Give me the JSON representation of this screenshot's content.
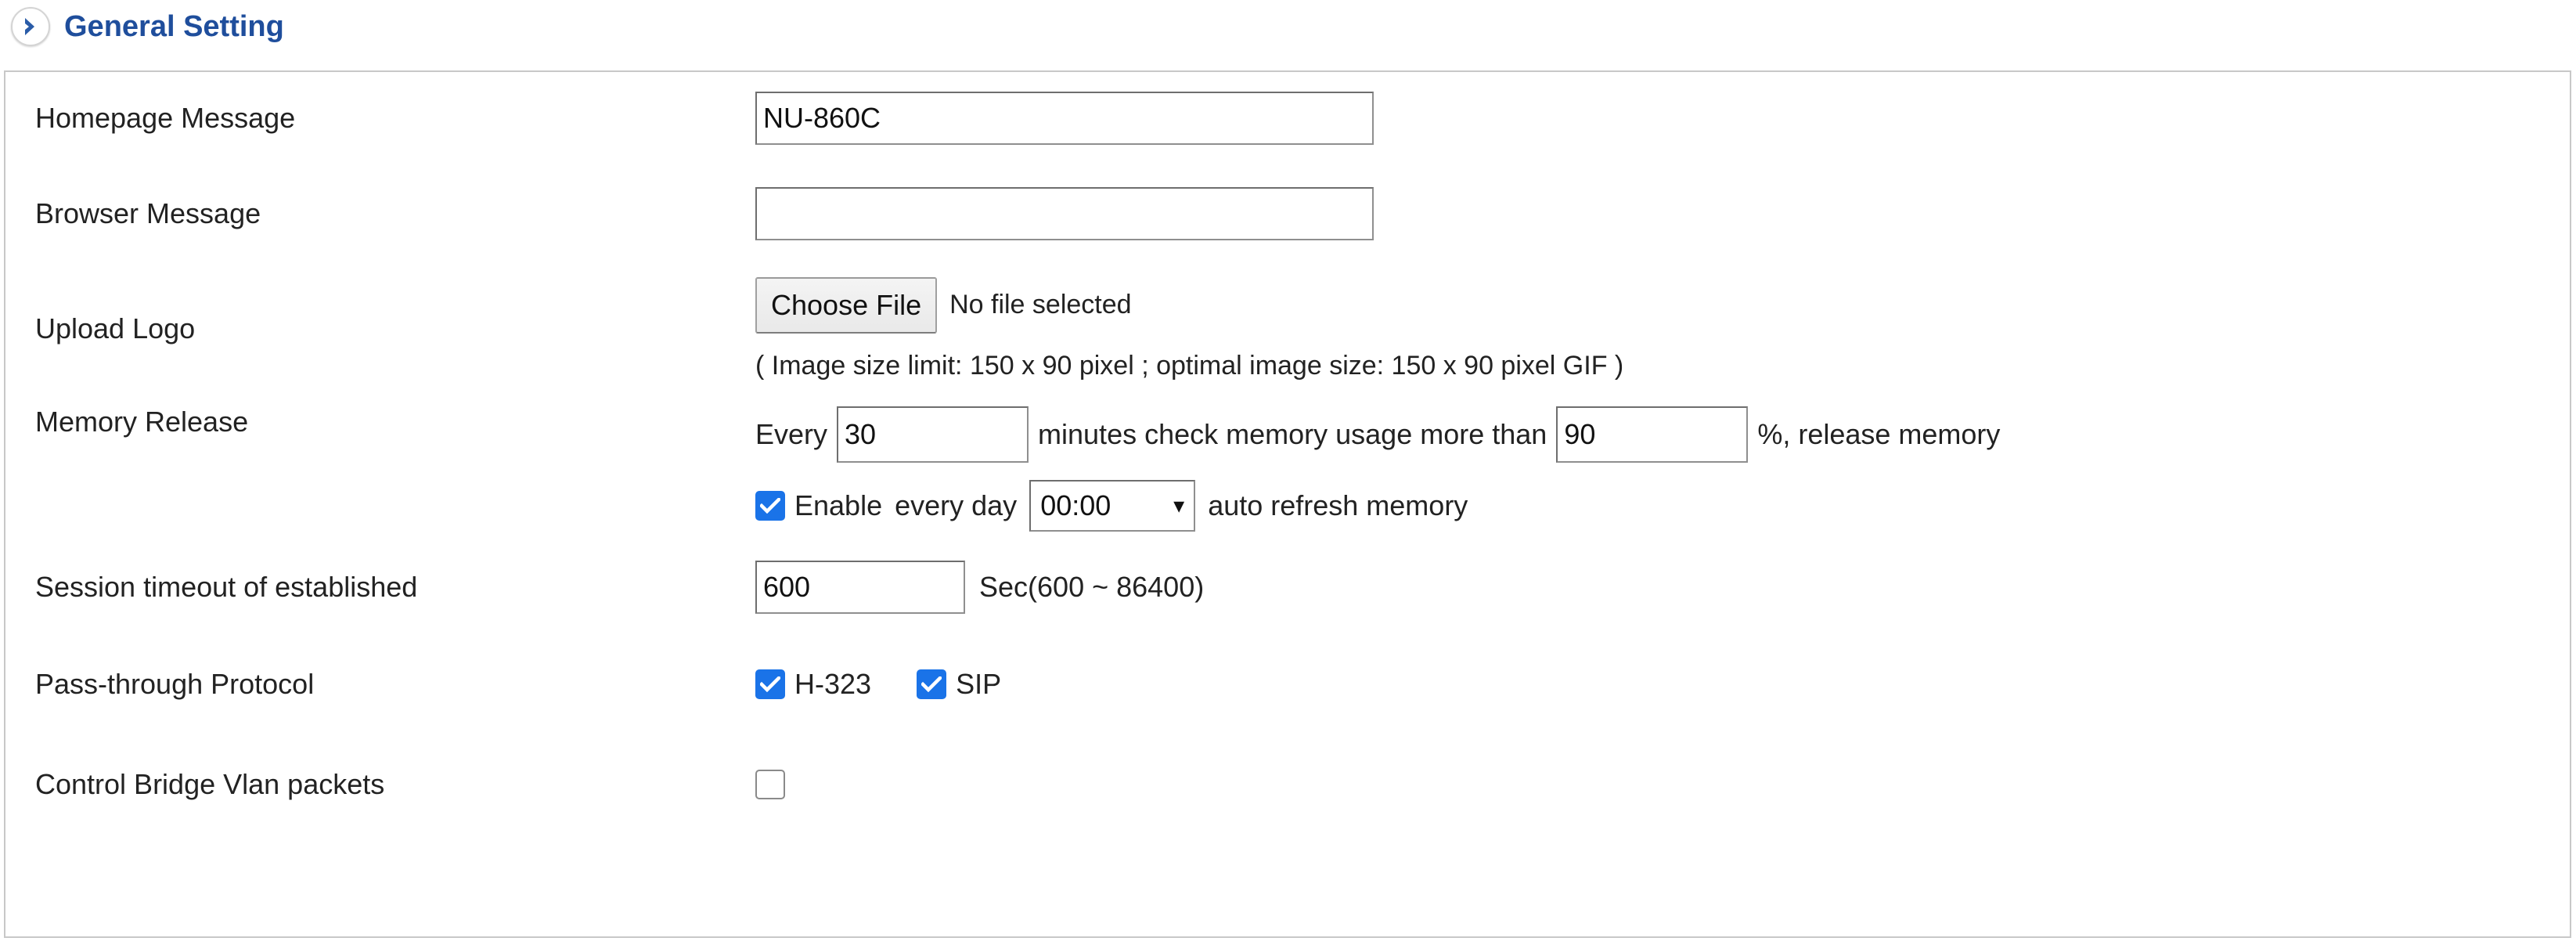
{
  "header": {
    "title": "General Setting",
    "expander_icon": "chevron-right-circle-icon"
  },
  "form": {
    "homepage_message": {
      "label": "Homepage Message",
      "value": "NU-860C",
      "placeholder": ""
    },
    "browser_message": {
      "label": "Browser Message",
      "value": "",
      "placeholder": ""
    },
    "upload_logo": {
      "label": "Upload Logo",
      "button_label": "Choose File",
      "file_status": "No file selected",
      "hint": "( Image size limit: 150 x 90 pixel ; optimal image size: 150 x 90 pixel GIF )"
    },
    "memory_release": {
      "label": "Memory Release",
      "prefix": "Every",
      "interval_minutes": "30",
      "middle": "minutes check memory usage more than",
      "threshold_percent": "90",
      "suffix": "%, release memory",
      "enable_checked": true,
      "enable_label": "Enable",
      "every_day_label": "every day",
      "time_value": "00:00",
      "time_options": [
        "00:00"
      ],
      "auto_refresh_label": "auto refresh memory",
      "caret_icon": "chevron-down-icon"
    },
    "session_timeout": {
      "label": "Session timeout of established",
      "value": "600",
      "unit_hint": "Sec(600 ~ 86400)"
    },
    "pass_through": {
      "label": "Pass-through Protocol",
      "options": [
        {
          "label": "H-323",
          "checked": true
        },
        {
          "label": "SIP",
          "checked": true
        }
      ]
    },
    "control_bridge_vlan": {
      "label": "Control Bridge Vlan packets",
      "checked": false
    }
  },
  "colors": {
    "title_blue": "#1f4e9c",
    "checkbox_blue": "#1a73e8",
    "border_gray": "#c8c8c8"
  }
}
